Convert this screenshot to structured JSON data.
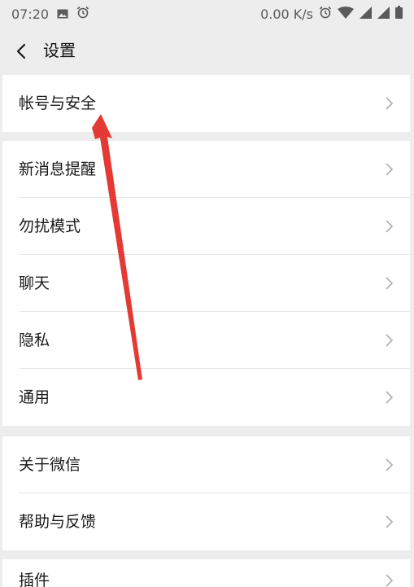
{
  "status_bar": {
    "time": "07:20",
    "speed": "0.00 K/s",
    "icons_left": [
      "image-icon",
      "alarm-icon"
    ],
    "icons_right": [
      "alarm-icon",
      "wifi-icon",
      "signal-icon",
      "signal-icon",
      "battery-icon"
    ]
  },
  "header": {
    "title": "设置",
    "back_icon": "chevron-left-icon"
  },
  "groups": [
    {
      "items": [
        {
          "label": "帐号与安全"
        }
      ]
    },
    {
      "items": [
        {
          "label": "新消息提醒"
        },
        {
          "label": "勿扰模式"
        },
        {
          "label": "聊天"
        },
        {
          "label": "隐私"
        },
        {
          "label": "通用"
        }
      ]
    },
    {
      "items": [
        {
          "label": "关于微信"
        },
        {
          "label": "帮助与反馈"
        }
      ]
    },
    {
      "items": [
        {
          "label": "插件"
        }
      ]
    }
  ],
  "colors": {
    "background": "#ededed",
    "row_background": "#ffffff",
    "annotation_arrow": "#e53935",
    "chevron": "#b2b2b2"
  }
}
